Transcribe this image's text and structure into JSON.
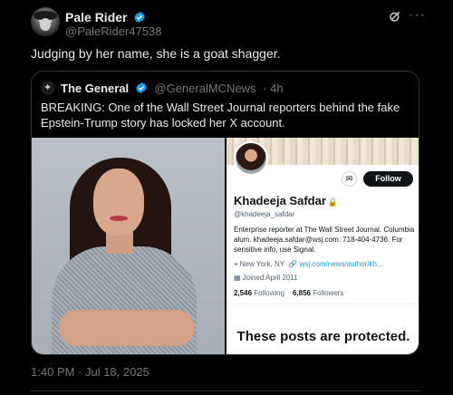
{
  "post": {
    "author_name": "Pale Rider",
    "author_handle": "@PaleRider47538",
    "text": "Judging by her name, she is a goat shagger.",
    "timestamp": "1:40 PM · Jul 18, 2025",
    "more_icon": "more-icon",
    "grok_icon": "grok-icon"
  },
  "quote": {
    "author_name": "The General",
    "author_handle": "@GeneralMCNews",
    "time": "· 4h",
    "text": "BREAKING: One of the Wall Street Journal reporters behind the fake Epstein-Trump story has locked her X account.",
    "profile_card": {
      "follow_label": "Follow",
      "name": "Khadeeja Safdar",
      "handle": "@khadeeja_safdar",
      "bio": "Enterprise reporter at The Wall Street Journal. Columbia alum. khadeeja.safdar@wsj.com. 718-404-4736. For sensitive info, use Signal.",
      "location": "New York, NY",
      "link": "wsj.com/news/author/kh...",
      "joined": "Joined April 2011",
      "following_count": "2,546",
      "following_label": "Following",
      "followers_count": "6,856",
      "followers_label": "Followers",
      "protected_text": "These posts are protected."
    }
  },
  "colors": {
    "background": "#000000",
    "text_primary": "#e7e9ea",
    "text_secondary": "#71767b",
    "verified_blue": "#1d9bf0",
    "border": "#2f3336"
  }
}
